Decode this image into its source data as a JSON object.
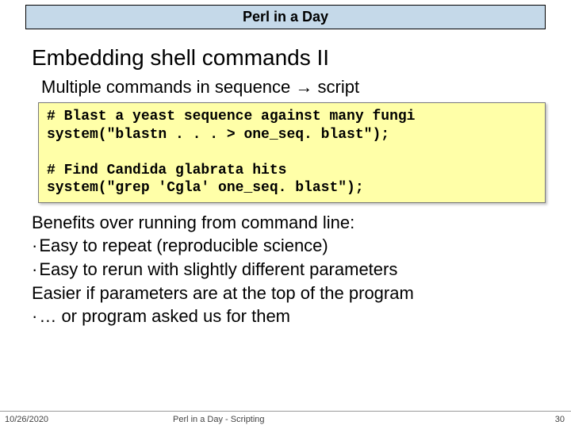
{
  "title": "Perl in a Day",
  "heading": "Embedding shell commands II",
  "subheading": "Multiple commands in sequence → script",
  "code": {
    "l1": "# Blast a yeast sequence against many fungi",
    "l2": "system(\"blastn . . . > one_seq. blast\");",
    "l3": "",
    "l4": "# Find Candida glabrata hits",
    "l5": "system(\"grep 'Cgla' one_seq. blast\");"
  },
  "body": {
    "l1": "Benefits over running from command line:",
    "l2": "Easy to repeat (reproducible science)",
    "l3": "Easy to rerun with slightly different parameters",
    "l4": "Easier if parameters are at the top of the program",
    "l5": "… or program asked us for them"
  },
  "footer": {
    "date": "10/26/2020",
    "mid": "Perl in a Day - Scripting",
    "page": "30"
  }
}
